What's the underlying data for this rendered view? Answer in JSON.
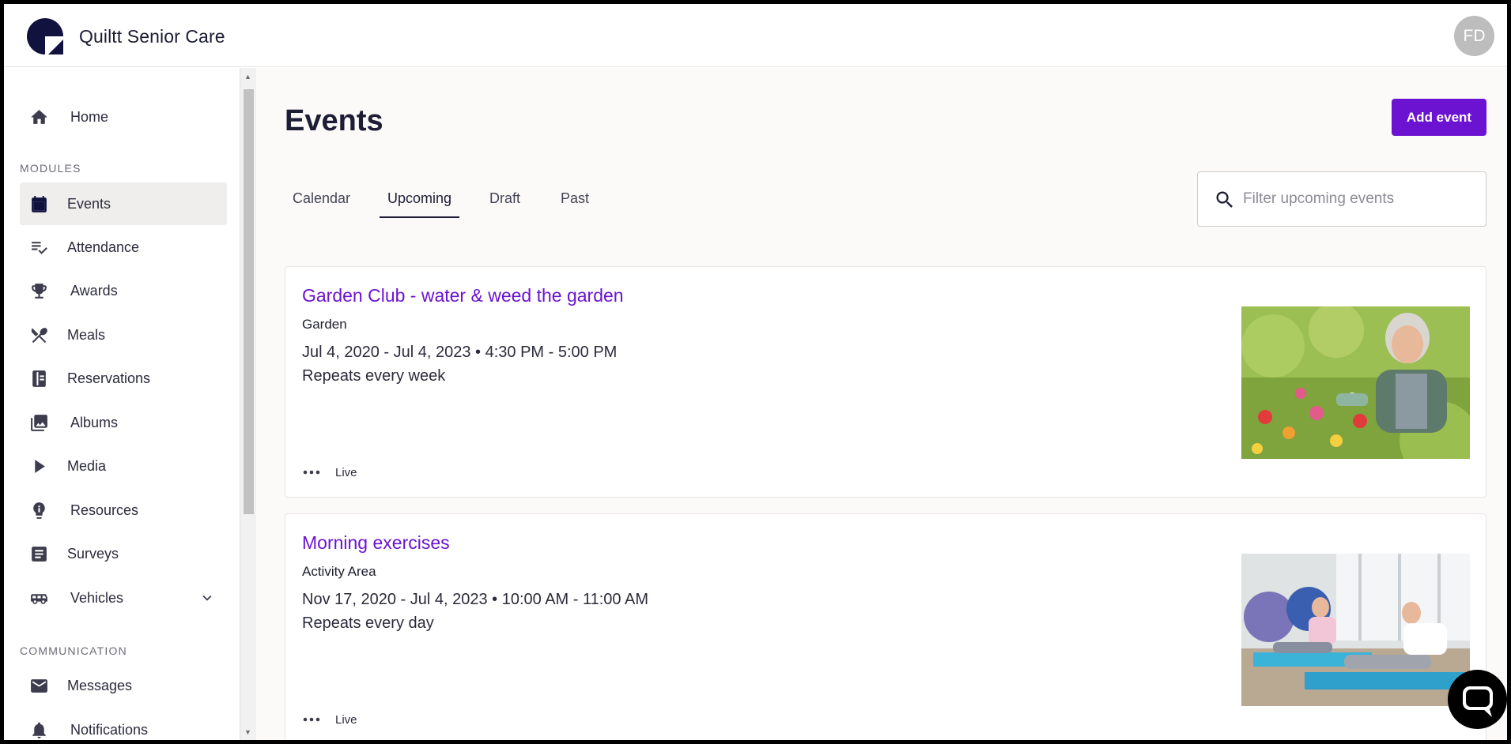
{
  "app": {
    "brand": "Quiltt Senior Care",
    "avatar_initials": "FD"
  },
  "sidebar": {
    "home": {
      "label": "Home",
      "icon": "home-icon"
    },
    "section_modules": "MODULES",
    "modules": [
      {
        "label": "Events",
        "icon": "calendar-icon",
        "active": true
      },
      {
        "label": "Attendance",
        "icon": "checklist-icon"
      },
      {
        "label": "Awards",
        "icon": "trophy-icon"
      },
      {
        "label": "Meals",
        "icon": "utensils-icon"
      },
      {
        "label": "Reservations",
        "icon": "book-icon"
      },
      {
        "label": "Albums",
        "icon": "photo-library-icon"
      },
      {
        "label": "Media",
        "icon": "play-icon"
      },
      {
        "label": "Resources",
        "icon": "lightbulb-icon"
      },
      {
        "label": "Surveys",
        "icon": "survey-icon"
      },
      {
        "label": "Vehicles",
        "icon": "bus-icon"
      }
    ],
    "section_communication": "COMMUNICATION",
    "communication": [
      {
        "label": "Messages",
        "icon": "mail-icon"
      },
      {
        "label": "Notifications",
        "icon": "bell-icon"
      }
    ]
  },
  "main": {
    "title": "Events",
    "add_button": "Add event",
    "tabs": [
      {
        "label": "Calendar"
      },
      {
        "label": "Upcoming",
        "active": true
      },
      {
        "label": "Draft"
      },
      {
        "label": "Past"
      }
    ],
    "search": {
      "placeholder": "Filter upcoming events",
      "value": ""
    },
    "events": [
      {
        "title": "Garden Club - water & weed the garden",
        "location": "Garden",
        "dates": "Jul 4, 2020 - Jul 4, 2023 • 4:30 PM - 5:00 PM",
        "repeat": "Repeats every week",
        "status": "Live"
      },
      {
        "title": "Morning exercises",
        "location": "Activity Area",
        "dates": "Nov 17, 2020 - Jul 4, 2023 • 10:00 AM - 11:00 AM",
        "repeat": "Repeats every day",
        "status": "Live"
      }
    ]
  },
  "colors": {
    "accent": "#6b13d1",
    "text_dark": "#1d1d35"
  }
}
